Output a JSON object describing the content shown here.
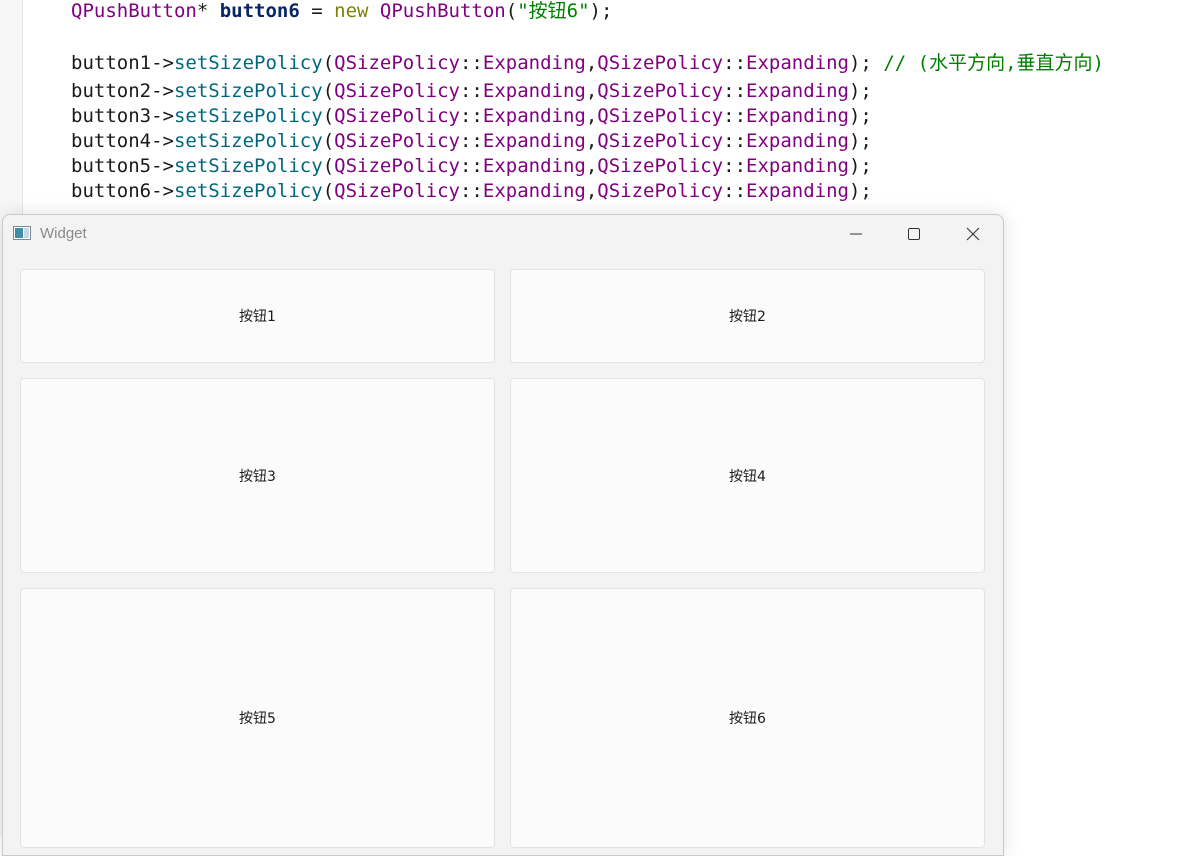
{
  "editor": {
    "line0": {
      "type": "QPushButton",
      "ptr": "* ",
      "var": "button6",
      "eq": " = ",
      "kw": "new",
      "ctor": " QPushButton",
      "open": "(",
      "str": "\"按钮6\"",
      "close": ");"
    },
    "policy_lines": [
      {
        "obj": "button1",
        "comment": "// (水平方向,垂直方向)"
      },
      {
        "obj": "button2"
      },
      {
        "obj": "button3"
      },
      {
        "obj": "button4"
      },
      {
        "obj": "button5"
      },
      {
        "obj": "button6"
      }
    ],
    "arrow": "->",
    "method": "setSizePolicy",
    "paren_open": "(",
    "cls": "QSizePolicy",
    "scope": "::",
    "policy": "Expanding",
    "comma": ",",
    "end": ");"
  },
  "window": {
    "title": "Widget",
    "icons": {
      "app": "qt-app-icon",
      "minimize": "minimize-icon",
      "maximize": "maximize-icon",
      "close": "close-icon"
    },
    "buttons": [
      "按钮1",
      "按钮2",
      "按钮3",
      "按钮4",
      "按钮5",
      "按钮6"
    ]
  }
}
